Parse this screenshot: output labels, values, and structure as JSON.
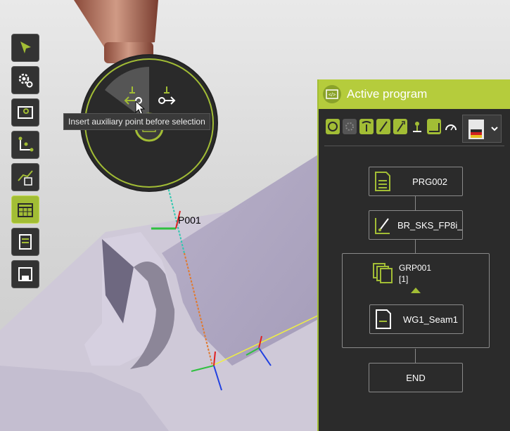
{
  "tooltip": "Insert auxiliary point before selection",
  "point_label": "P001",
  "panel": {
    "title": "Active program"
  },
  "program_tree": {
    "start": "PRG002",
    "tool": "BR_SKS_FP8i_...",
    "group_name": "GRP001",
    "group_count": "[1]",
    "seam": "WG1_Seam1",
    "end": "END"
  },
  "toolbar_icons": [
    "cursor-icon",
    "settings-gear-icon",
    "image-map-icon",
    "axis-frame-icon",
    "path-insert-icon",
    "calendar-grid-icon",
    "document-list-icon",
    "save-disk-icon"
  ],
  "colors": {
    "accent": "#a2bd35",
    "panel_bg": "#2b2b2b"
  }
}
